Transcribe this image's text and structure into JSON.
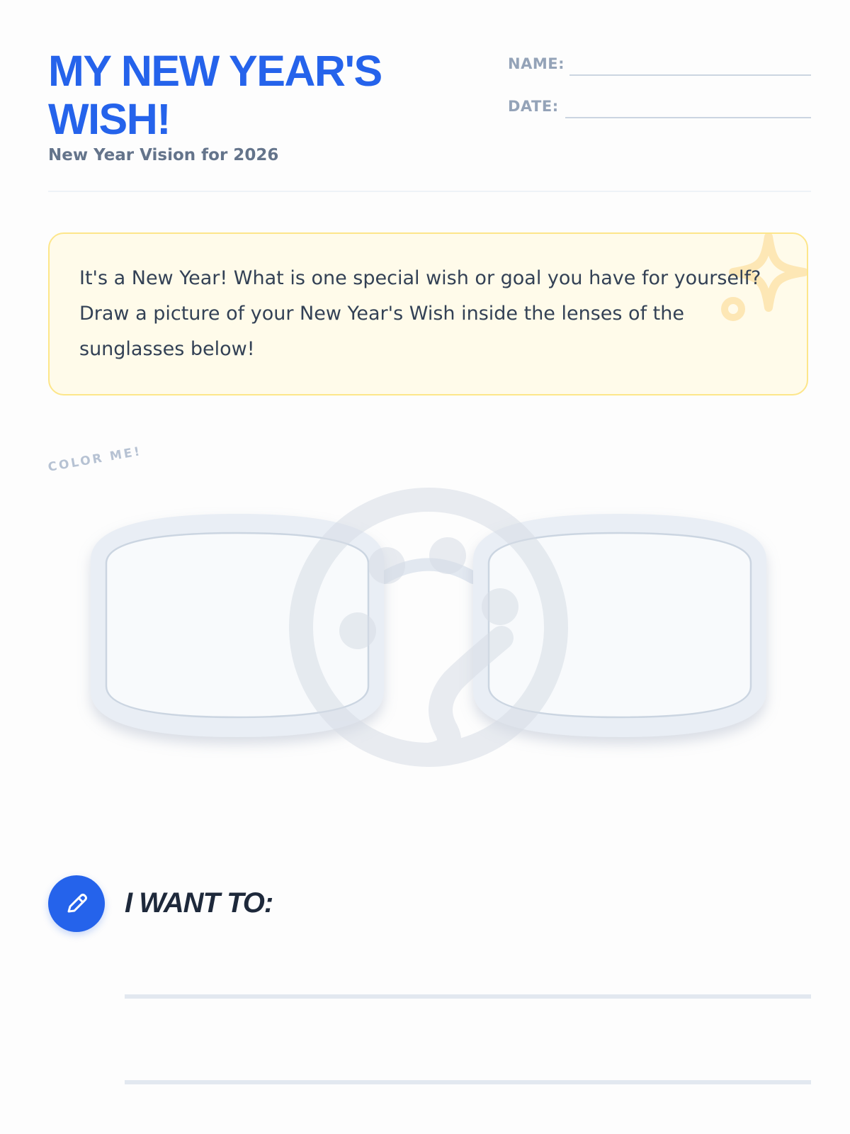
{
  "header": {
    "title": "MY NEW YEAR'S WISH!",
    "subtitle": "New Year Vision for 2026",
    "name_label": "NAME:",
    "date_label": "DATE:"
  },
  "instructions": {
    "text": "It's a New Year! What is one special wish or goal you have for yourself? Draw a picture of your New Year's Wish inside the lenses of the sunglasses below!"
  },
  "drawing": {
    "tag": "COLOR ME!",
    "illustration_icon": "sunglasses-icon",
    "watermark_icon": "smiley-face-icon",
    "corner_icon": "sparkle-icon"
  },
  "wish": {
    "heading": "I WANT TO:",
    "icon": "pencil-icon"
  },
  "colors": {
    "accent_blue": "#2563eb",
    "subtitle_gray": "#64748b",
    "label_gray": "#94a3b8",
    "instruction_bg": "#fffbea",
    "instruction_border": "#fde68a",
    "frame_gray": "#e2e8f0"
  }
}
